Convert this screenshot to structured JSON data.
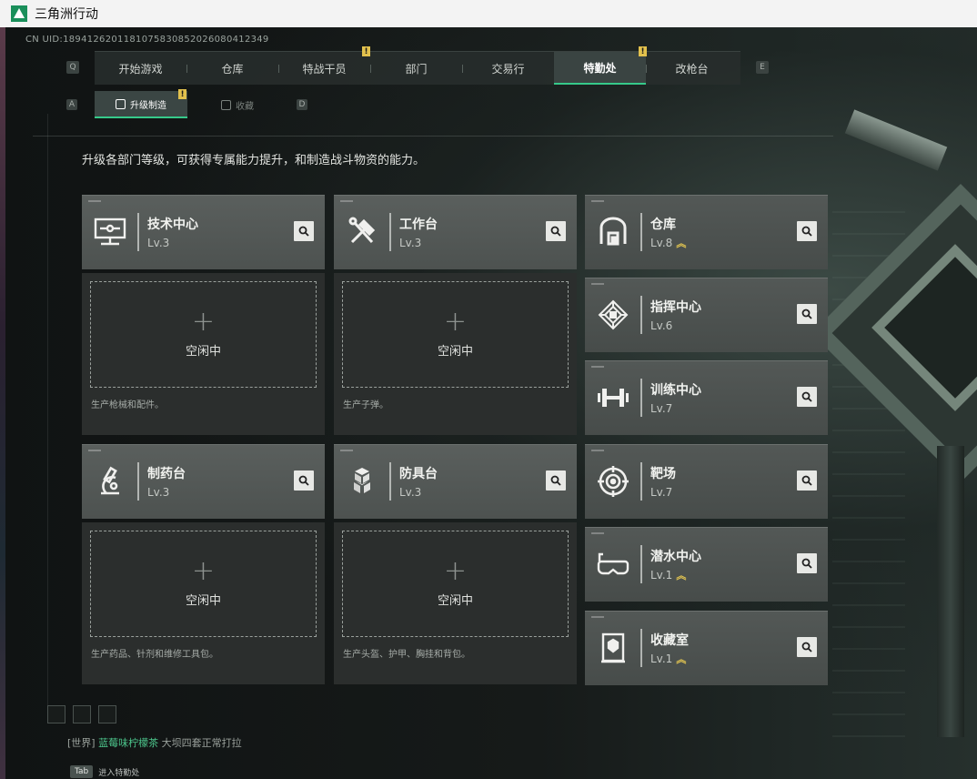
{
  "window": {
    "title": "三角洲行动"
  },
  "uid_text": "CN UID:1894126201181075830852026080412349",
  "nav": {
    "left_key": "Q",
    "right_key": "E",
    "items": [
      {
        "label": "开始游戏"
      },
      {
        "label": "仓库"
      },
      {
        "label": "特战干员",
        "alert": "!"
      },
      {
        "label": "部门"
      },
      {
        "label": "交易行"
      },
      {
        "label": "特勤处",
        "alert": "!",
        "active": true
      },
      {
        "label": "改枪台"
      }
    ]
  },
  "subnav": {
    "left_key": "A",
    "right_key": "D",
    "tabs": [
      {
        "label": "升级制造",
        "alert": "!",
        "active": true
      },
      {
        "label": "收藏"
      }
    ]
  },
  "description": "升级各部门等级，可获得专属能力提升，和制造战斗物资的能力。",
  "facilities_left": [
    {
      "name": "技术中心",
      "level": "Lv.3",
      "icon": "computer-icon",
      "slot_status": "空闲中",
      "slot_note": "生产枪械和配件。"
    },
    {
      "name": "工作台",
      "level": "Lv.3",
      "icon": "tools-icon",
      "slot_status": "空闲中",
      "slot_note": "生产子弹。"
    },
    {
      "name": "制药台",
      "level": "Lv.3",
      "icon": "microscope-icon",
      "slot_status": "空闲中",
      "slot_note": "生产药品、针剂和维修工具包。"
    },
    {
      "name": "防具台",
      "level": "Lv.3",
      "icon": "armor-cubes-icon",
      "slot_status": "空闲中",
      "slot_note": "生产头盔、护甲、胸挂和背包。"
    }
  ],
  "facilities_right": [
    {
      "name": "仓库",
      "level": "Lv.8",
      "icon": "warehouse-icon",
      "upgradable": true
    },
    {
      "name": "指挥中心",
      "level": "Lv.6",
      "icon": "command-chip-icon",
      "upgradable": false
    },
    {
      "name": "训练中心",
      "level": "Lv.7",
      "icon": "dumbbell-icon",
      "upgradable": false
    },
    {
      "name": "靶场",
      "level": "Lv.7",
      "icon": "target-icon",
      "upgradable": false
    },
    {
      "name": "潜水中心",
      "level": "Lv.1",
      "icon": "diving-mask-icon",
      "upgradable": true
    },
    {
      "name": "收藏室",
      "level": "Lv.1",
      "icon": "display-case-icon",
      "upgradable": true
    }
  ],
  "chat": {
    "channel": "[世界]",
    "player": "蓝莓味柠檬茶",
    "message": "大坝四套正常打拉"
  },
  "tab_hint": {
    "key": "Tab",
    "label": "进入特勤处"
  },
  "upgrade_chevron": "︽",
  "plus_glyph": "+",
  "colors": {
    "accent_green": "#36c98a",
    "alert_yellow": "#e2c14d",
    "upgrade_gold": "#e4c651"
  }
}
